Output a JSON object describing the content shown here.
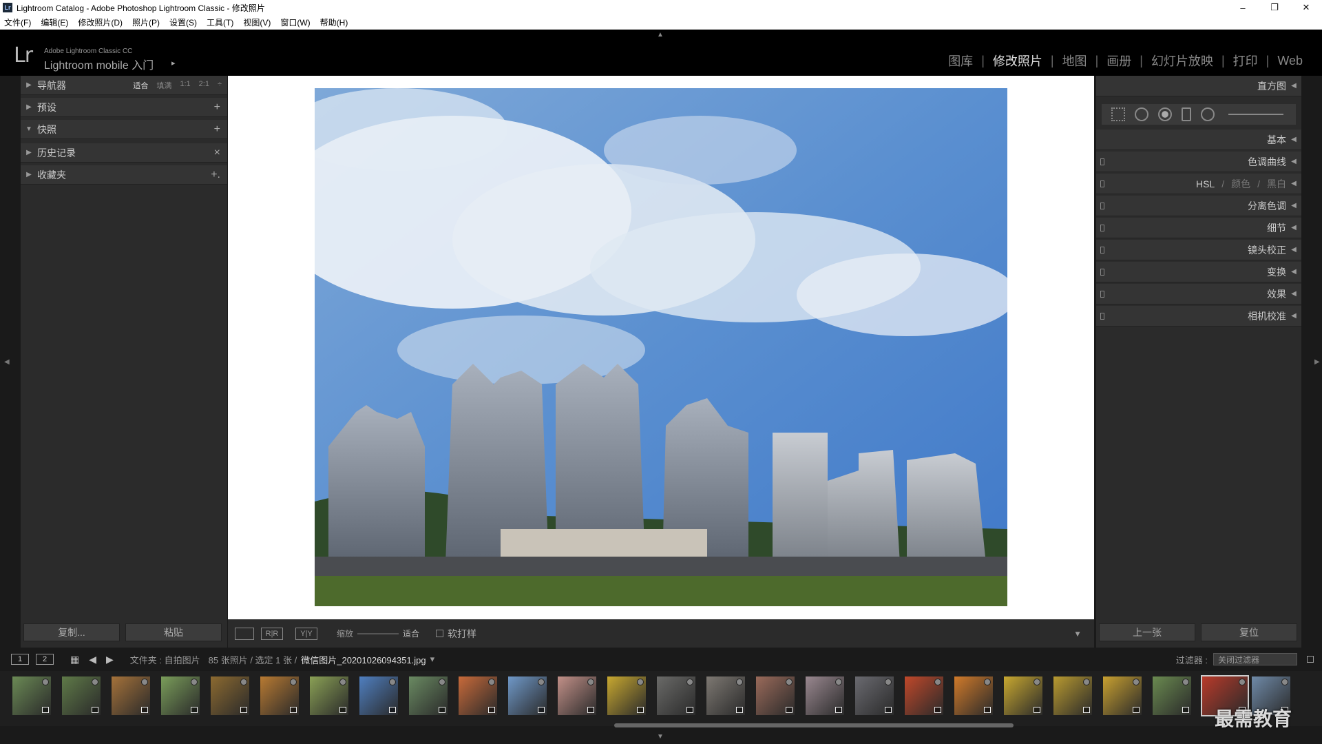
{
  "window": {
    "title": "Lightroom Catalog - Adobe Photoshop Lightroom Classic - 修改照片",
    "app_icon": "Lr",
    "minimize": "–",
    "maximize": "❐",
    "close": "✕"
  },
  "menu": [
    "文件(F)",
    "编辑(E)",
    "修改照片(D)",
    "照片(P)",
    "设置(S)",
    "工具(T)",
    "视图(V)",
    "窗口(W)",
    "帮助(H)"
  ],
  "identity": {
    "logo": "Lr",
    "product": "Adobe Lightroom Classic CC",
    "mobile": "Lightroom mobile 入门",
    "arrow": "▸"
  },
  "modules": [
    {
      "label": "图库",
      "active": false
    },
    {
      "label": "修改照片",
      "active": true
    },
    {
      "label": "地图",
      "active": false
    },
    {
      "label": "画册",
      "active": false
    },
    {
      "label": "幻灯片放映",
      "active": false
    },
    {
      "label": "打印",
      "active": false
    },
    {
      "label": "Web",
      "active": false
    }
  ],
  "left_panel": {
    "navigator": {
      "label": "导航器",
      "zoom": [
        "适合",
        "填满",
        "1:1",
        "2:1"
      ],
      "zoom_active": "适合",
      "zoom_arrow": "÷"
    },
    "presets": {
      "label": "预设",
      "action": "+"
    },
    "snapshots": {
      "label": "快照",
      "action": "+"
    },
    "history": {
      "label": "历史记录",
      "action": "×"
    },
    "collections": {
      "label": "收藏夹",
      "action": "+."
    },
    "copy_button": "复制...",
    "paste_button": "粘贴"
  },
  "toolbar": {
    "view_loupe": "",
    "view_compare": "R|R",
    "view_before_after": "Y|Y",
    "zoom_label": "缩放",
    "zoom_value": "适合",
    "softproof": "软打样",
    "dropdown": "▼"
  },
  "right_panel": {
    "histogram": "直方图",
    "basic": "基本",
    "tone_curve": "色调曲线",
    "hsl": "HSL",
    "hsl_sep": "/",
    "color": "颜色",
    "bw": "黑白",
    "split_toning": "分离色调",
    "detail": "细节",
    "lens": "镜头校正",
    "transform": "变换",
    "effects": "效果",
    "calibration": "相机校准",
    "prev_button": "上一张",
    "reset_button": "复位"
  },
  "filmbar": {
    "page1": "1",
    "page2": "2",
    "folder_prefix": "文件夹 : 自拍图片",
    "count": "85 张照片 / 选定 1 张 /",
    "filename": "微信图片_20201026094351.jpg",
    "filename_arrow": "▾",
    "filter_label": "过滤器 :",
    "filter_value": "关闭过滤器"
  },
  "watermark": "最需教育",
  "colors": {
    "accent": "#dddddd",
    "panel": "#2b2b2b",
    "header": "#343434"
  },
  "thumbs": [
    "#6b8a55",
    "#5f7a48",
    "#a5723a",
    "#7a9d5a",
    "#8c6a30",
    "#b87a32",
    "#8aa055",
    "#4f7fc0",
    "#6a8a62",
    "#c86a3a",
    "#6f98c8",
    "#c29088",
    "#c8a830",
    "#6a6a68",
    "#7d7872",
    "#9a6a5a",
    "#9a8890",
    "#6a6a70",
    "#c0482a",
    "#d07a2a",
    "#c8a830",
    "#b89a30",
    "#c8a030",
    "#6a8a50",
    "#b83a2a",
    "#6f8aa8"
  ]
}
